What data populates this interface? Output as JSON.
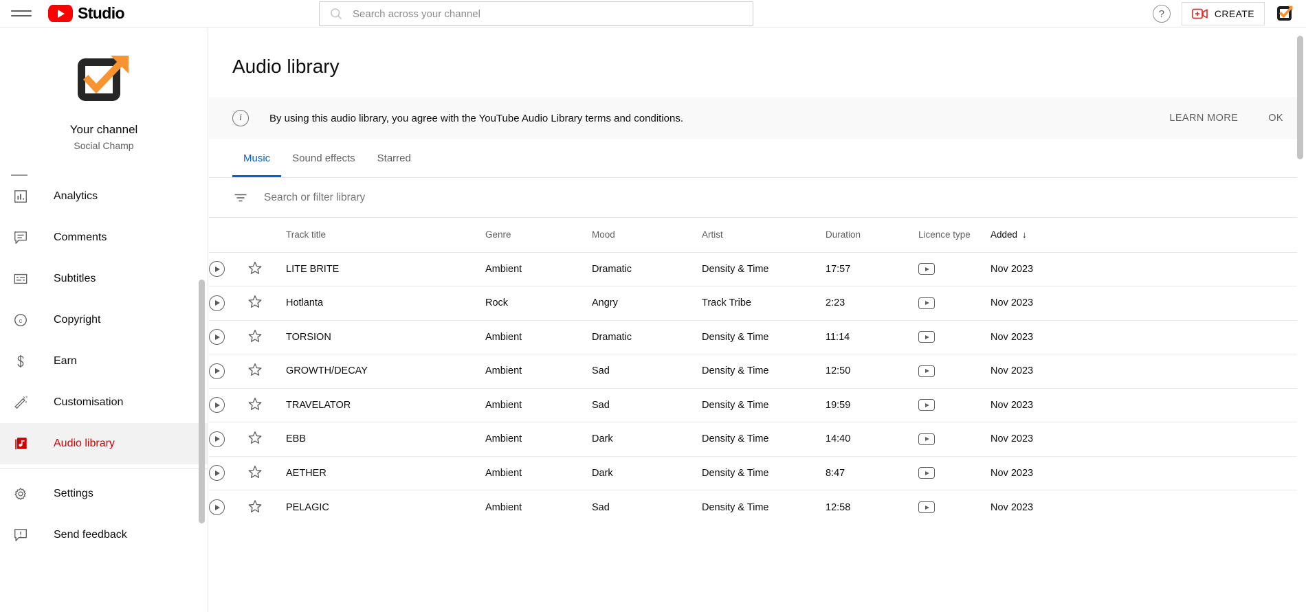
{
  "topbar": {
    "menu_icon": "hamburger-icon",
    "brand": "Studio",
    "search_placeholder": "Search across your channel",
    "search_value": "",
    "help_label": "?",
    "create_label": "CREATE"
  },
  "sidebar": {
    "channel_title": "Your channel",
    "channel_name": "Social Champ",
    "items": [
      {
        "label": "Analytics",
        "icon": "analytics-icon",
        "active": false
      },
      {
        "label": "Comments",
        "icon": "comments-icon",
        "active": false
      },
      {
        "label": "Subtitles",
        "icon": "subtitles-icon",
        "active": false
      },
      {
        "label": "Copyright",
        "icon": "copyright-icon",
        "active": false
      },
      {
        "label": "Earn",
        "icon": "dollar-icon",
        "active": false
      },
      {
        "label": "Customisation",
        "icon": "magic-wand-icon",
        "active": false
      },
      {
        "label": "Audio library",
        "icon": "audio-library-icon",
        "active": true
      }
    ],
    "footer_items": [
      {
        "label": "Settings",
        "icon": "gear-icon"
      },
      {
        "label": "Send feedback",
        "icon": "feedback-icon"
      }
    ]
  },
  "main": {
    "page_title": "Audio library",
    "notice": {
      "icon": "info-icon",
      "text": "By using this audio library, you agree with the YouTube Audio Library terms and conditions.",
      "learn_more": "LEARN MORE",
      "ok": "OK"
    },
    "tabs": [
      {
        "label": "Music",
        "active": true
      },
      {
        "label": "Sound effects",
        "active": false
      },
      {
        "label": "Starred",
        "active": false
      }
    ],
    "filter": {
      "icon": "filter-icon",
      "placeholder": "Search or filter library",
      "value": ""
    },
    "table": {
      "headers": {
        "play": "",
        "star": "",
        "title": "Track title",
        "genre": "Genre",
        "mood": "Mood",
        "artist": "Artist",
        "duration": "Duration",
        "licence": "Licence type",
        "added": "Added"
      },
      "sort_column": "Added",
      "sort_direction": "descending",
      "sort_arrow": "↓",
      "rows": [
        {
          "title": "LITE BRITE",
          "genre": "Ambient",
          "mood": "Dramatic",
          "artist": "Density & Time",
          "duration": "17:57",
          "licence": "youtube-badge-icon",
          "added": "Nov 2023"
        },
        {
          "title": "Hotlanta",
          "genre": "Rock",
          "mood": "Angry",
          "artist": "Track Tribe",
          "duration": "2:23",
          "licence": "youtube-badge-icon",
          "added": "Nov 2023"
        },
        {
          "title": "TORSION",
          "genre": "Ambient",
          "mood": "Dramatic",
          "artist": "Density & Time",
          "duration": "11:14",
          "licence": "youtube-badge-icon",
          "added": "Nov 2023"
        },
        {
          "title": "GROWTH/DECAY",
          "genre": "Ambient",
          "mood": "Sad",
          "artist": "Density & Time",
          "duration": "12:50",
          "licence": "youtube-badge-icon",
          "added": "Nov 2023"
        },
        {
          "title": "TRAVELATOR",
          "genre": "Ambient",
          "mood": "Sad",
          "artist": "Density & Time",
          "duration": "19:59",
          "licence": "youtube-badge-icon",
          "added": "Nov 2023"
        },
        {
          "title": "EBB",
          "genre": "Ambient",
          "mood": "Dark",
          "artist": "Density & Time",
          "duration": "14:40",
          "licence": "youtube-badge-icon",
          "added": "Nov 2023"
        },
        {
          "title": "AETHER",
          "genre": "Ambient",
          "mood": "Dark",
          "artist": "Density & Time",
          "duration": "8:47",
          "licence": "youtube-badge-icon",
          "added": "Nov 2023"
        },
        {
          "title": "PELAGIC",
          "genre": "Ambient",
          "mood": "Sad",
          "artist": "Density & Time",
          "duration": "12:58",
          "licence": "youtube-badge-icon",
          "added": "Nov 2023"
        }
      ]
    }
  },
  "colors": {
    "brand_red": "#ff0000",
    "active_red": "#d40000",
    "tab_blue": "#065fd4",
    "logo_orange": "#f79331",
    "notice_bg": "#f9f9f9"
  }
}
